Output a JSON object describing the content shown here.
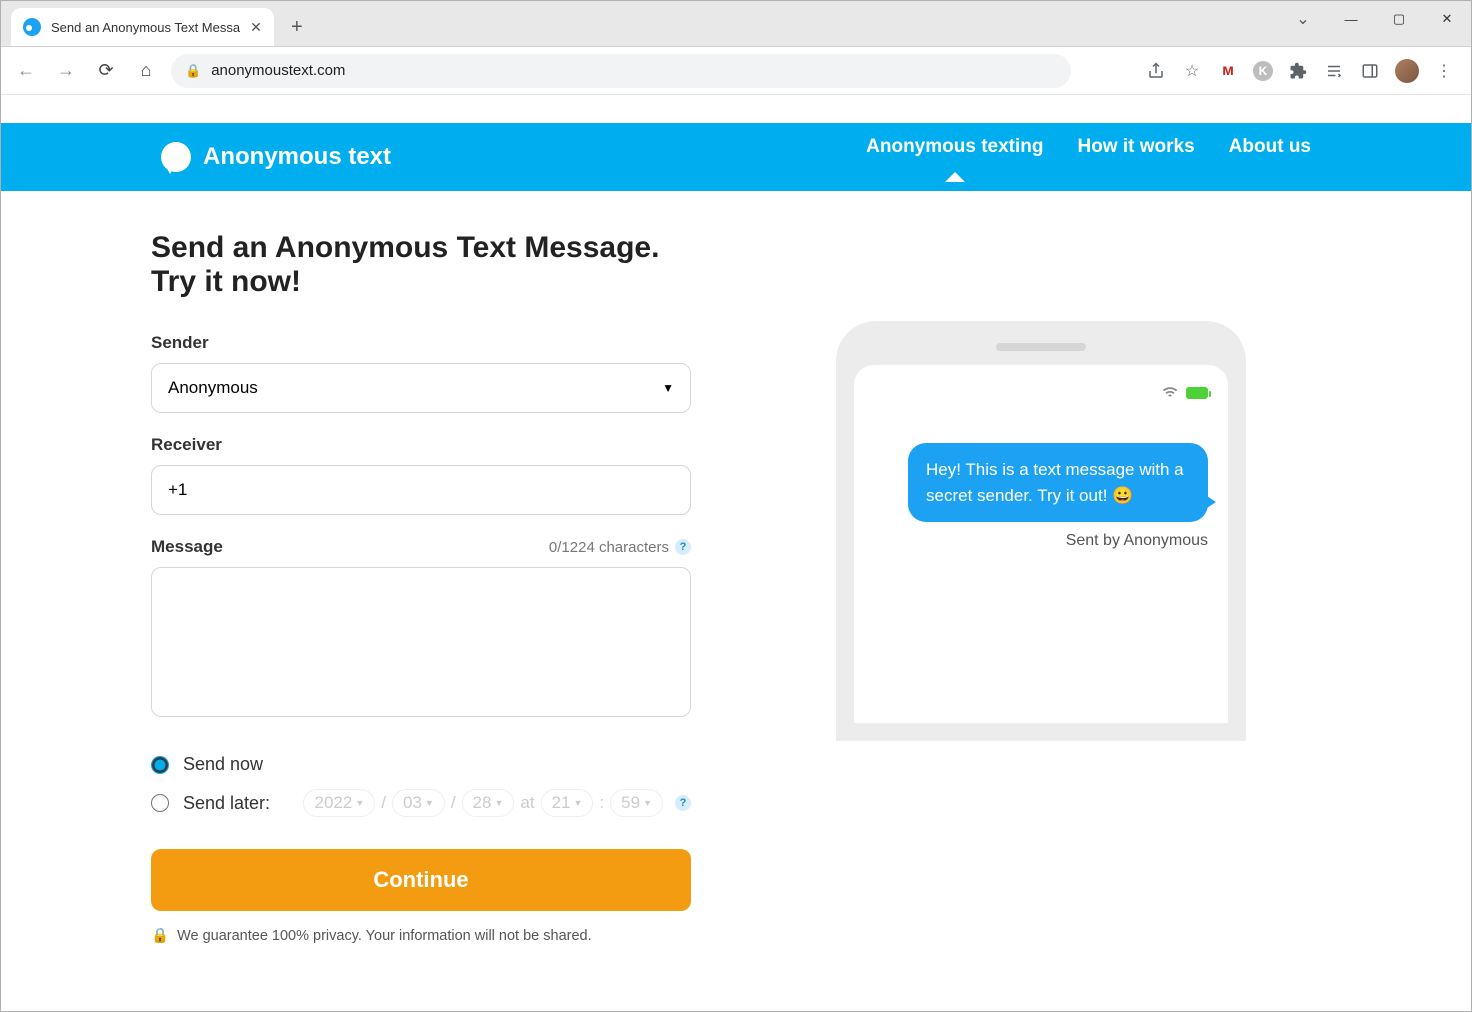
{
  "browser": {
    "tab_title": "Send an Anonymous Text Messa",
    "url": "anonymoustext.com"
  },
  "header": {
    "brand": "Anonymous text",
    "nav": {
      "texting": "Anonymous texting",
      "how": "How it works",
      "about": "About us"
    }
  },
  "page": {
    "heading": "Send an Anonymous Text Message. Try it now!",
    "sender_label": "Sender",
    "sender_value": "Anonymous",
    "receiver_label": "Receiver",
    "receiver_value": "+1",
    "message_label": "Message",
    "char_counter": "0/1224 characters",
    "message_value": "",
    "send_now_label": "Send now",
    "send_later_label": "Send later:",
    "schedule": {
      "year": "2022",
      "month": "03",
      "day": "28",
      "at": "at",
      "hour": "21",
      "minute": "59",
      "slash": "/",
      "colon": ":"
    },
    "continue_label": "Continue",
    "privacy_text": "We guarantee 100% privacy. Your information will not be shared."
  },
  "mock": {
    "bubble_text": "Hey! This is a text message with a secret sender. Try it out! 😀",
    "sent_by": "Sent by Anonymous"
  }
}
